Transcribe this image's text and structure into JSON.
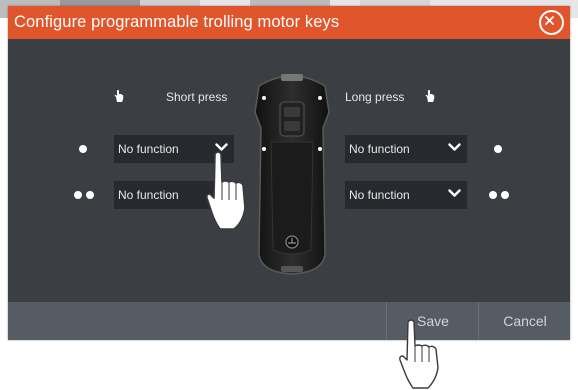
{
  "dialog": {
    "title": "Configure programmable trolling motor keys",
    "close_icon": "close-circle-icon"
  },
  "columns": {
    "short_press": "Short press",
    "long_press": "Long press"
  },
  "rows": [
    {
      "indicator": "single-dot",
      "short_value": "No function",
      "long_value": "No function"
    },
    {
      "indicator": "double-dot",
      "short_value": "No function",
      "long_value": "No function"
    }
  ],
  "footer": {
    "save_label": "Save",
    "cancel_label": "Cancel"
  },
  "colors": {
    "title_bar": "#e0552b",
    "dialog_body": "#3b3f44",
    "dropdown": "#262a2e",
    "footer": "#565c64"
  }
}
